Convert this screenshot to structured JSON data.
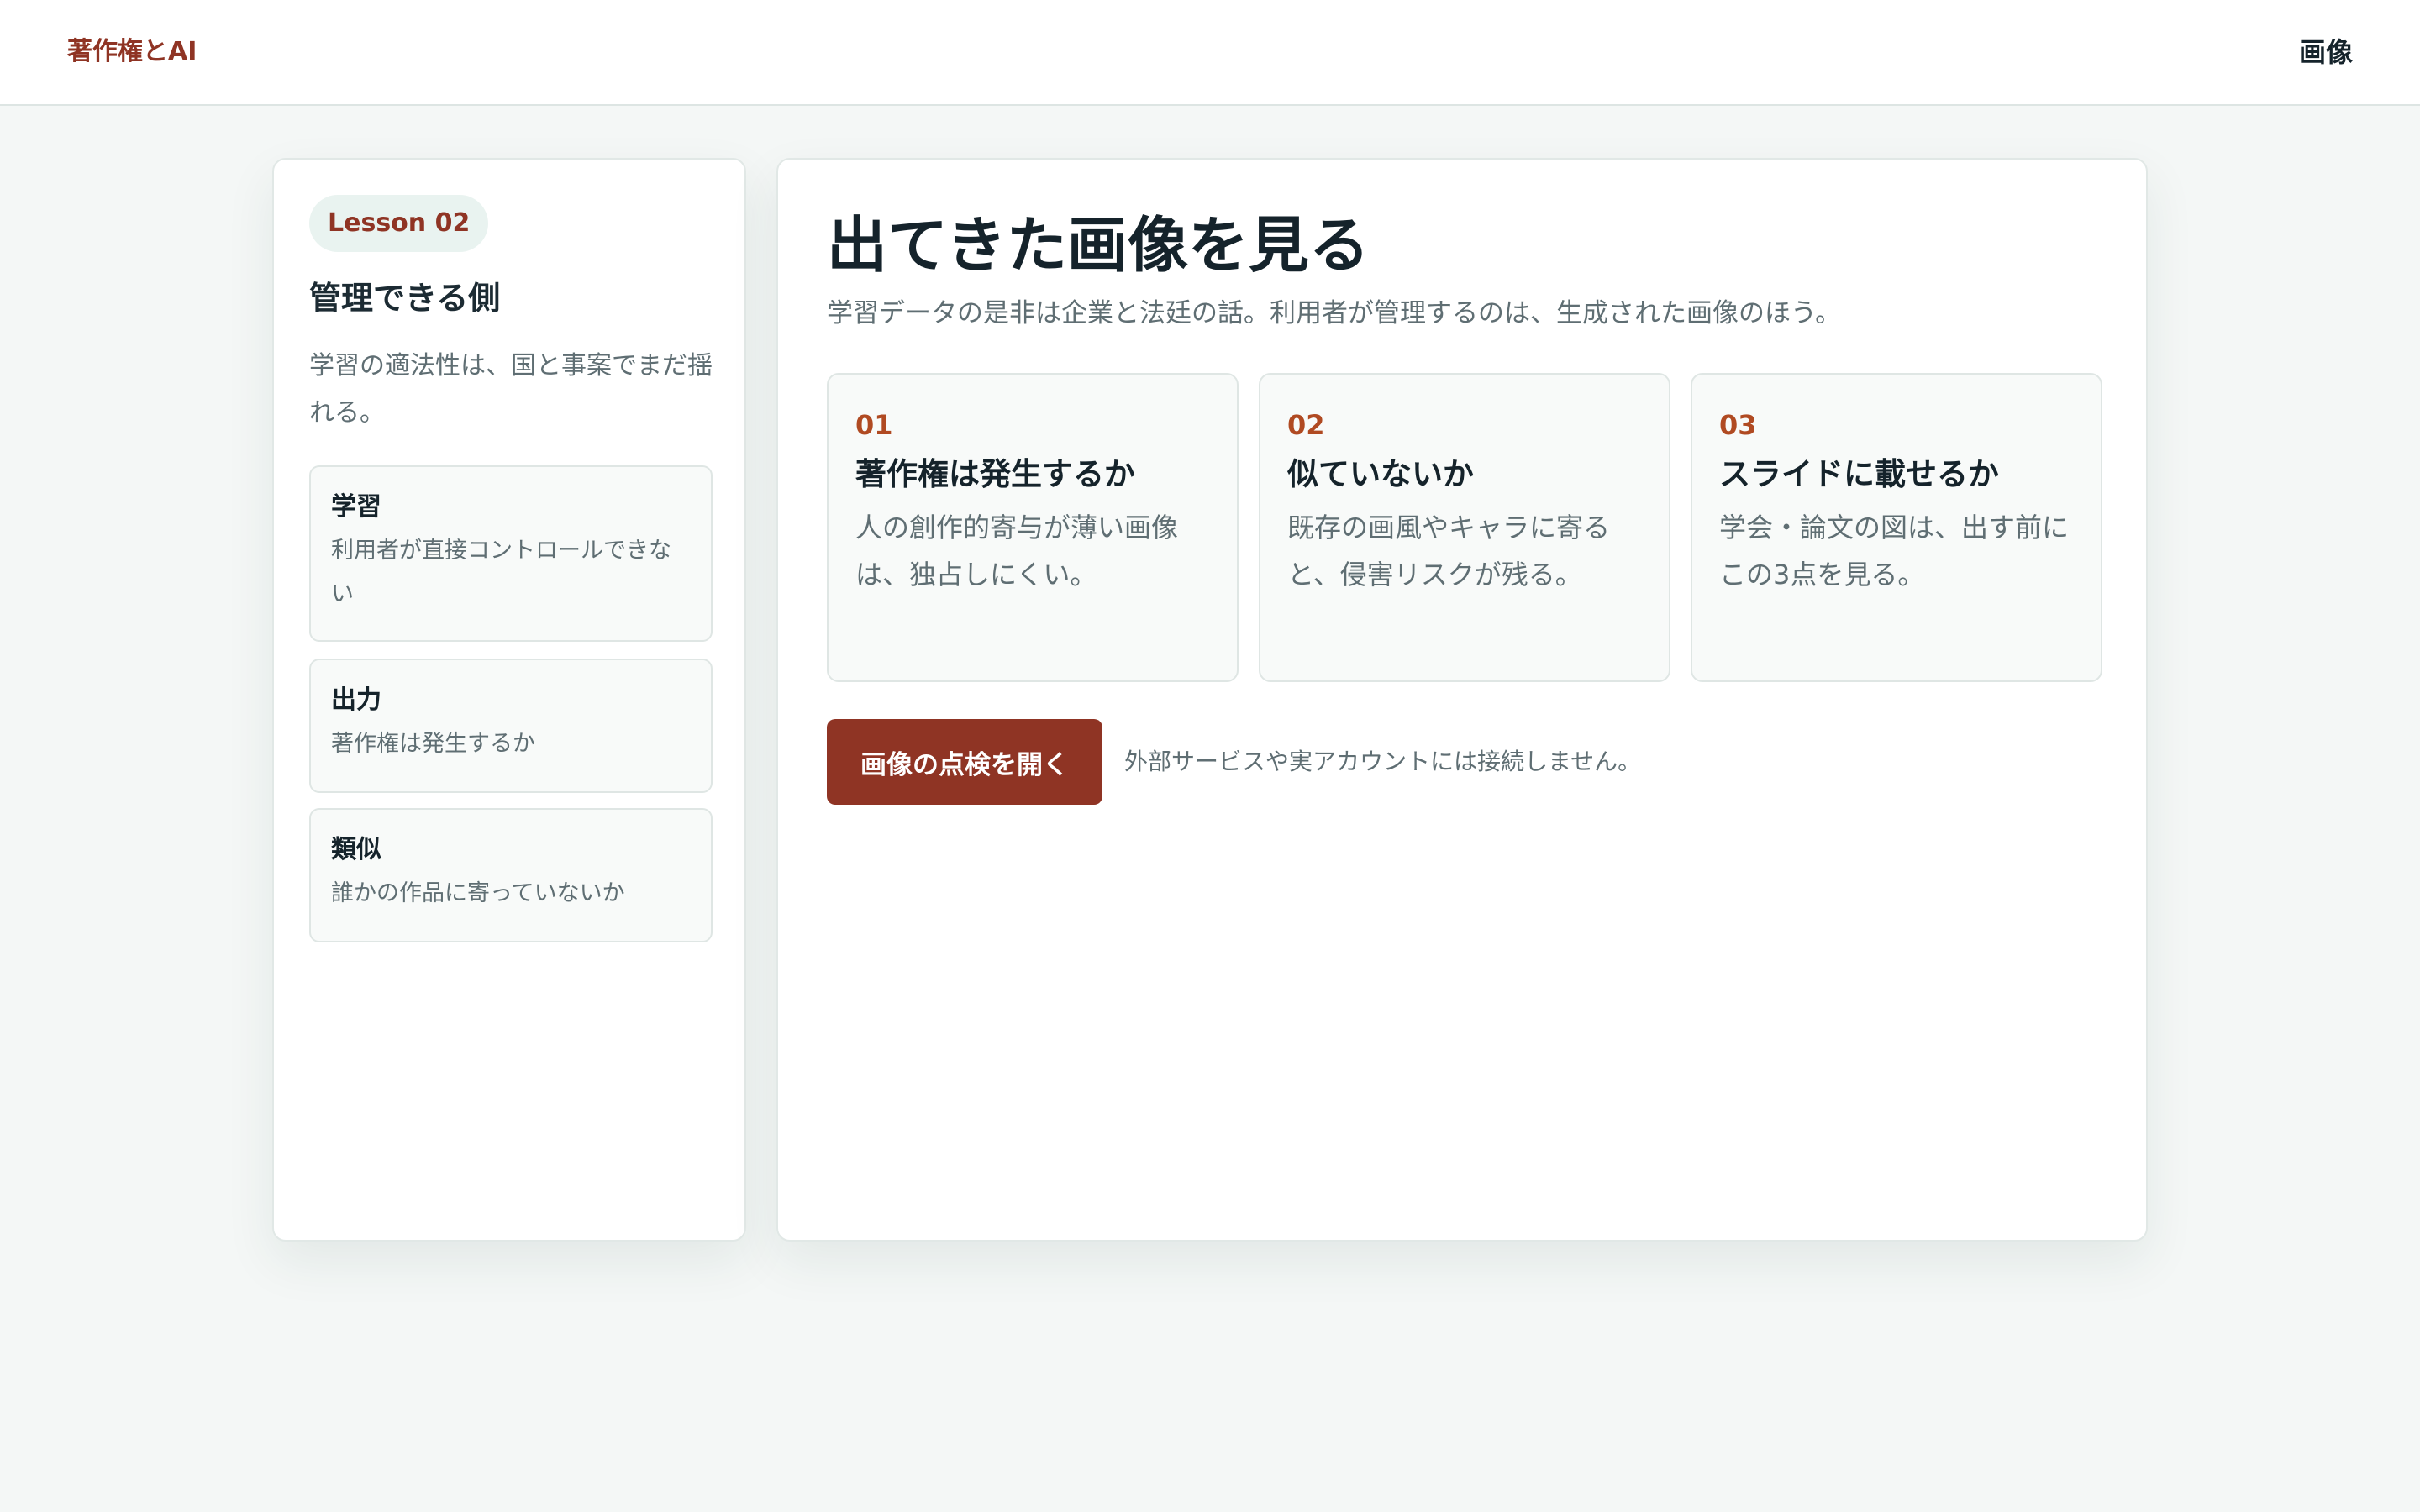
{
  "header": {
    "brand": "著作権とAI",
    "nav_label": "画像"
  },
  "sidebar": {
    "badge": "Lesson 02",
    "title": "管理できる側",
    "description": "学習の適法性は、国と事案でまだ揺れる。",
    "items": [
      {
        "title": "学習",
        "description": "利用者が直接コントロールできない"
      },
      {
        "title": "出力",
        "description": "著作権は発生するか"
      },
      {
        "title": "類似",
        "description": "誰かの作品に寄っていないか"
      }
    ]
  },
  "main": {
    "title": "出てきた画像を見る",
    "subtitle": "学習データの是非は企業と法廷の話。利用者が管理するのは、生成された画像のほう。",
    "steps": [
      {
        "number": "01",
        "title": "著作権は発生するか",
        "description": "人の創作的寄与が薄い画像は、独占しにくい。"
      },
      {
        "number": "02",
        "title": "似ていないか",
        "description": "既存の画風やキャラに寄ると、侵害リスクが残る。"
      },
      {
        "number": "03",
        "title": "スライドに載せるか",
        "description": "学会・論文の図は、出す前にこの3点を見る。"
      }
    ],
    "cta_label": "画像の点検を開く",
    "note": "外部サービスや実アカウントには接続しません。"
  },
  "colors": {
    "accent": "#8f3424",
    "step_number": "#b04a22",
    "page_bg": "#f4f7f6",
    "badge_bg": "#e9f3f0"
  }
}
